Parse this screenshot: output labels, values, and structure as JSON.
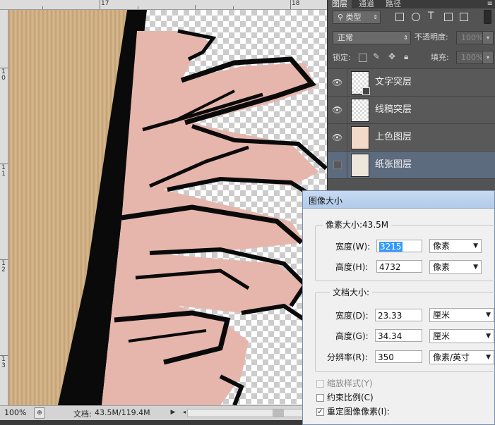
{
  "ruler": {
    "top_labels": [
      "17",
      "18"
    ],
    "left_labels": [
      "1\n0",
      "1\n1",
      "1\n2",
      "1\n3"
    ]
  },
  "status": {
    "zoom": "100%",
    "doc_label": "文档:",
    "doc_value": "43.5M/119.4M"
  },
  "layers_panel": {
    "tabs": [
      "图层",
      "通道",
      "路径"
    ],
    "filter_kind": "类型",
    "blend_mode": "正常",
    "opacity_label": "不透明度:",
    "opacity_value": "100%",
    "lock_label": "锁定:",
    "fill_label": "填充:",
    "fill_value": "100%",
    "layers": [
      {
        "name": "文字突层",
        "visible": true,
        "selected": false
      },
      {
        "name": "线稿突层",
        "visible": true,
        "selected": false
      },
      {
        "name": "上色图层",
        "visible": true,
        "selected": false
      },
      {
        "name": "纸张图层",
        "visible": false,
        "selected": true
      }
    ]
  },
  "image_size_dialog": {
    "title": "图像大小",
    "pixel_dimensions": "像素大小:43.5M",
    "width_label": "宽度(W):",
    "width_value": "3215",
    "width_unit": "像素",
    "height_label": "高度(H):",
    "height_value": "4732",
    "height_unit": "像素",
    "document_size": "文档大小:",
    "doc_width_label": "宽度(D):",
    "doc_width_value": "23.33",
    "doc_width_unit": "厘米",
    "doc_height_label": "高度(G):",
    "doc_height_value": "34.34",
    "doc_height_unit": "厘米",
    "resolution_label": "分辨率(R):",
    "resolution_value": "350",
    "resolution_unit": "像素/英寸",
    "scale_styles": {
      "label": "缩放样式(Y)",
      "checked": false,
      "enabled": false
    },
    "constrain": {
      "label": "约束比例(C)",
      "checked": false,
      "enabled": true
    },
    "resample": {
      "label": "重定图像像素(I):",
      "checked": true,
      "enabled": true
    }
  },
  "colors": {
    "skin": "#e6b6ad",
    "ink": "#0a0a0a",
    "wood": "#cfae83",
    "selection": "#5d6b7f",
    "highlight": "#3399ff"
  }
}
